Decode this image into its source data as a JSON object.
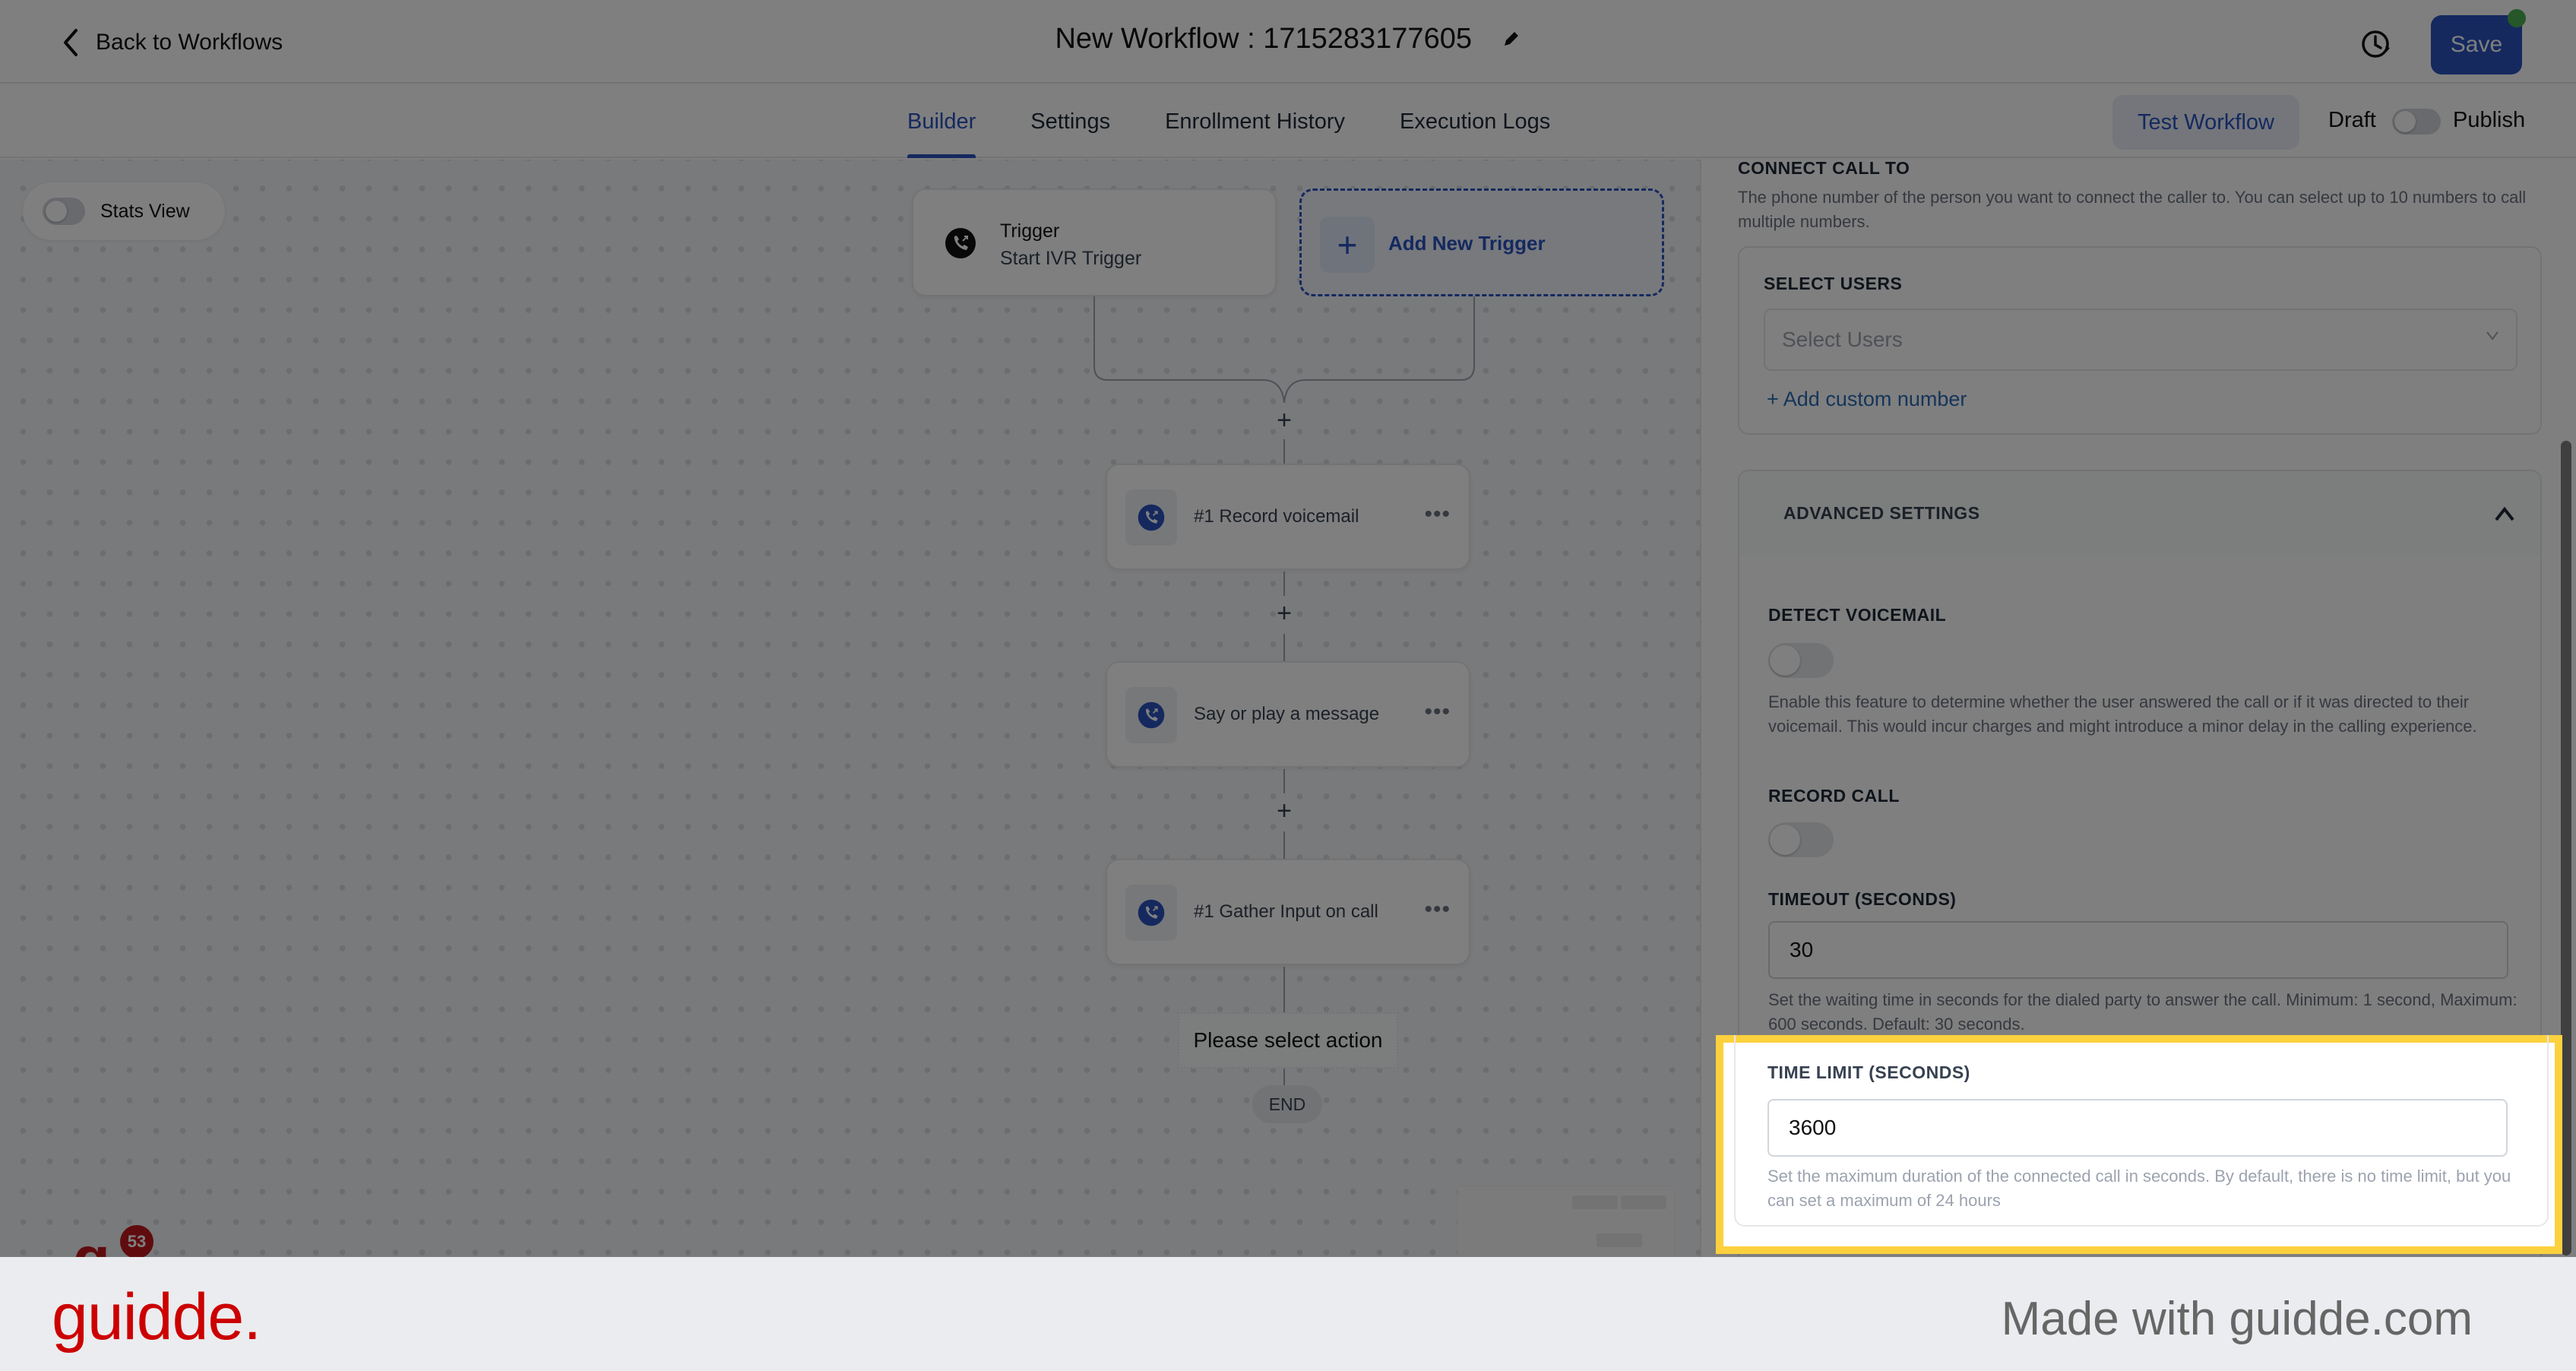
{
  "header": {
    "back_label": "Back to Workflows",
    "title": "New Workflow : 1715283177605",
    "save_label": "Save"
  },
  "tabs": [
    {
      "label": "Builder",
      "active": true
    },
    {
      "label": "Settings",
      "active": false
    },
    {
      "label": "Enrollment History",
      "active": false
    },
    {
      "label": "Execution Logs",
      "active": false
    }
  ],
  "toolbar": {
    "test_workflow_label": "Test Workflow",
    "draft_label": "Draft",
    "publish_label": "Publish",
    "publish_toggle_on": false
  },
  "canvas": {
    "stats_view_label": "Stats View",
    "stats_view_on": false,
    "trigger": {
      "title": "Trigger",
      "subtitle": "Start IVR Trigger"
    },
    "add_trigger_label": "Add New Trigger",
    "add_symbol": "+",
    "actions": [
      {
        "label": "#1 Record voicemail"
      },
      {
        "label": "Say or play a message"
      },
      {
        "label": "#1 Gather Input on call"
      }
    ],
    "more_symbol": "•••",
    "select_action_label": "Please select action",
    "end_label": "END",
    "notification_count": "53"
  },
  "panel": {
    "connect_call_to": {
      "title": "CONNECT CALL TO",
      "help": "The phone number of the person you want to connect the caller to. You can select up to 10 numbers to call multiple numbers."
    },
    "select_users": {
      "label": "SELECT USERS",
      "placeholder": "Select Users",
      "add_custom_label": "+ Add custom number"
    },
    "advanced_settings": {
      "title": "ADVANCED SETTINGS",
      "expanded": true
    },
    "detect_voicemail": {
      "label": "DETECT VOICEMAIL",
      "on": false,
      "help": "Enable this feature to determine whether the user answered the call or if it was directed to their voicemail. This would incur charges and might introduce a minor delay in the calling experience."
    },
    "record_call": {
      "label": "RECORD CALL",
      "on": false
    },
    "timeout": {
      "label": "TIMEOUT (SECONDS)",
      "value": "30",
      "help": "Set the waiting time in seconds for the dialed party to answer the call. Minimum: 1 second, Maximum: 600 seconds. Default: 30 seconds."
    },
    "time_limit": {
      "label": "TIME LIMIT (SECONDS)",
      "value": "3600",
      "help": "Set the maximum duration of the connected call in seconds. By default, there is no time limit, but you can set a maximum of 24 hours"
    }
  },
  "colors": {
    "accent": "#2a52be",
    "highlight": "#fdd13e",
    "brand": "#cc0000",
    "save_dot": "#4caf50"
  },
  "footer": {
    "brand": "guidde.",
    "made_with": "Made with guidde.com"
  }
}
